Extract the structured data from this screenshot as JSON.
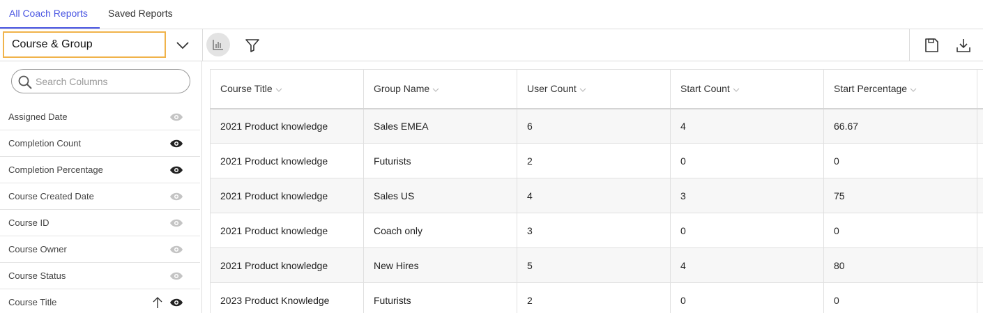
{
  "tabs": [
    {
      "label": "All Coach Reports",
      "active": true
    },
    {
      "label": "Saved Reports",
      "active": false
    }
  ],
  "toolbar": {
    "report_type": "Course & Group",
    "icons": [
      "chevron-down-icon",
      "bar-chart-icon",
      "filter-icon",
      "save-icon",
      "download-icon"
    ]
  },
  "columns_panel": {
    "search_placeholder": "Search Columns",
    "items": [
      {
        "label": "Assigned Date",
        "visible": false
      },
      {
        "label": "Completion Count",
        "visible": true
      },
      {
        "label": "Completion Percentage",
        "visible": true
      },
      {
        "label": "Course Created Date",
        "visible": false
      },
      {
        "label": "Course ID",
        "visible": false
      },
      {
        "label": "Course Owner",
        "visible": false
      },
      {
        "label": "Course Status",
        "visible": false
      },
      {
        "label": "Course Title",
        "visible": true,
        "sort": "ascending"
      }
    ]
  },
  "table": {
    "headers": [
      "Course Title",
      "Group Name",
      "User Count",
      "Start Count",
      "Start Percentage"
    ],
    "rows": [
      [
        "2021 Product knowledge",
        "Sales EMEA",
        "6",
        "4",
        "66.67"
      ],
      [
        "2021 Product knowledge",
        "Futurists",
        "2",
        "0",
        "0"
      ],
      [
        "2021 Product knowledge",
        "Sales US",
        "4",
        "3",
        "75"
      ],
      [
        "2021 Product knowledge",
        "Coach only",
        "3",
        "0",
        "0"
      ],
      [
        "2021 Product knowledge",
        "New Hires",
        "5",
        "4",
        "80"
      ],
      [
        "2023 Product Knowledge",
        "Futurists",
        "2",
        "0",
        "0"
      ]
    ]
  },
  "colors": {
    "accent": "#4a56e2",
    "select_border": "#f0b34a",
    "eye_visible": "#222222",
    "eye_hidden": "#c4c4c4"
  }
}
